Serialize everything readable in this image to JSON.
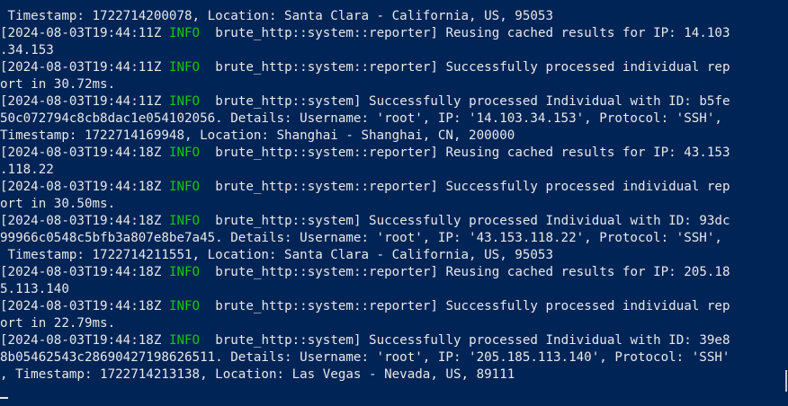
{
  "terminal": {
    "lines": [
      {
        "type": "text",
        "text": " Timestamp: 1722714200078, Location: Santa Clara - California, US, 95053"
      },
      {
        "type": "log",
        "ts": "2024-08-03T19:44:11Z",
        "level": "INFO",
        "target": "brute_http::system::reporter",
        "msg": " Reusing cached results for IP: 14.103"
      },
      {
        "type": "text",
        "text": ".34.153"
      },
      {
        "type": "log",
        "ts": "2024-08-03T19:44:11Z",
        "level": "INFO",
        "target": "brute_http::system::reporter",
        "msg": " Successfully processed individual rep"
      },
      {
        "type": "text",
        "text": "ort in 30.72ms."
      },
      {
        "type": "log",
        "ts": "2024-08-03T19:44:11Z",
        "level": "INFO",
        "target": "brute_http::system",
        "msg": " Successfully processed Individual with ID: b5fe"
      },
      {
        "type": "text",
        "text": "50c072794c8cb8dac1e054102056. Details: Username: 'root', IP: '14.103.34.153', Protocol: 'SSH',"
      },
      {
        "type": "text",
        "text": "Timestamp: 1722714169948, Location: Shanghai - Shanghai, CN, 200000"
      },
      {
        "type": "log",
        "ts": "2024-08-03T19:44:18Z",
        "level": "INFO",
        "target": "brute_http::system::reporter",
        "msg": " Reusing cached results for IP: 43.153"
      },
      {
        "type": "text",
        "text": ".118.22"
      },
      {
        "type": "log",
        "ts": "2024-08-03T19:44:18Z",
        "level": "INFO",
        "target": "brute_http::system::reporter",
        "msg": " Successfully processed individual rep"
      },
      {
        "type": "text",
        "text": "ort in 30.50ms."
      },
      {
        "type": "log",
        "ts": "2024-08-03T19:44:18Z",
        "level": "INFO",
        "target": "brute_http::system",
        "msg": " Successfully processed Individual with ID: 93dc"
      },
      {
        "type": "text",
        "text": "99966c0548c5bfb3a807e8be7a45. Details: Username: 'root', IP: '43.153.118.22', Protocol: 'SSH',"
      },
      {
        "type": "text",
        "text": " Timestamp: 1722714211551, Location: Santa Clara - California, US, 95053"
      },
      {
        "type": "log",
        "ts": "2024-08-03T19:44:18Z",
        "level": "INFO",
        "target": "brute_http::system::reporter",
        "msg": " Reusing cached results for IP: 205.18"
      },
      {
        "type": "text",
        "text": "5.113.140"
      },
      {
        "type": "log",
        "ts": "2024-08-03T19:44:18Z",
        "level": "INFO",
        "target": "brute_http::system::reporter",
        "msg": " Successfully processed individual rep"
      },
      {
        "type": "text",
        "text": "ort in 22.79ms."
      },
      {
        "type": "log",
        "ts": "2024-08-03T19:44:18Z",
        "level": "INFO",
        "target": "brute_http::system",
        "msg": " Successfully processed Individual with ID: 39e8"
      },
      {
        "type": "text",
        "text": "8b05462543c28690427198626511. Details: Username: 'root', IP: '205.185.113.140', Protocol: 'SSH'"
      },
      {
        "type": "text",
        "text": ", Timestamp: 1722714213138, Location: Las Vegas - Nevada, US, 89111"
      }
    ]
  },
  "colors": {
    "background": "#012456",
    "text": "#e8e8e8",
    "info": "#16c60c"
  }
}
